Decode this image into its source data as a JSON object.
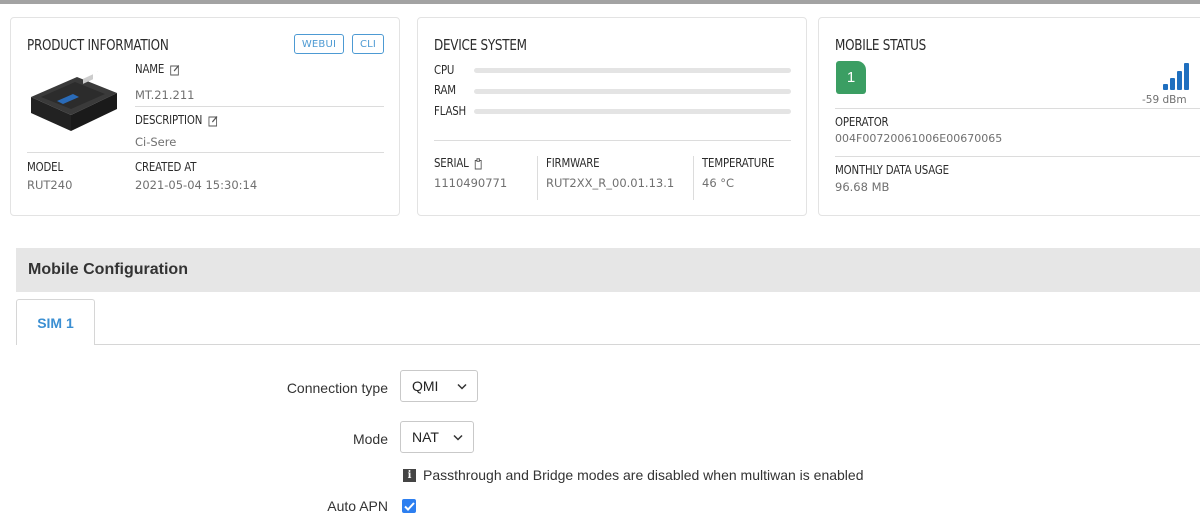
{
  "product": {
    "title": "PRODUCT INFORMATION",
    "webui_label": "WEBUI",
    "cli_label": "CLI",
    "name_label": "NAME",
    "name_value": "MT.21.211",
    "description_label": "DESCRIPTION",
    "description_value": "Ci-Sere",
    "model_label": "MODEL",
    "model_value": "RUT240",
    "created_label": "CREATED AT",
    "created_value": "2021-05-04 15:30:14"
  },
  "device": {
    "title": "DEVICE SYSTEM",
    "cpu_label": "CPU",
    "ram_label": "RAM",
    "flash_label": "FLASH",
    "cpu_usage": 0,
    "ram_usage": 0,
    "flash_usage": 0,
    "serial_label": "SERIAL",
    "serial_value": "1110490771",
    "firmware_label": "FIRMWARE",
    "firmware_value": "RUT2XX_R_00.01.13.1",
    "temperature_label": "TEMPERATURE",
    "temperature_value": "46 °C"
  },
  "mobile": {
    "title": "MOBILE STATUS",
    "sim_number": "1",
    "signal_value": "-59 dBm",
    "signal_bars": 4,
    "operator_label": "OPERATOR",
    "operator_value": "004F00720061006E00670065",
    "data_usage_label": "MONTHLY DATA USAGE",
    "data_usage_value": "96.68 MB"
  },
  "config": {
    "section_title": "Mobile Configuration",
    "tab_label": "SIM 1",
    "connection_type_label": "Connection type",
    "connection_type_value": "QMI",
    "mode_label": "Mode",
    "mode_value": "NAT",
    "info_text": "Passthrough and Bridge modes are disabled when multiwan is enabled",
    "auto_apn_label": "Auto APN",
    "auto_apn_checked": true
  },
  "colors": {
    "accent": "#4d9ad3",
    "tab_text": "#3b8fd2",
    "sim_badge": "#3b9e63",
    "signal": "#1f6fbf",
    "checkbox": "#2d7ff0"
  }
}
